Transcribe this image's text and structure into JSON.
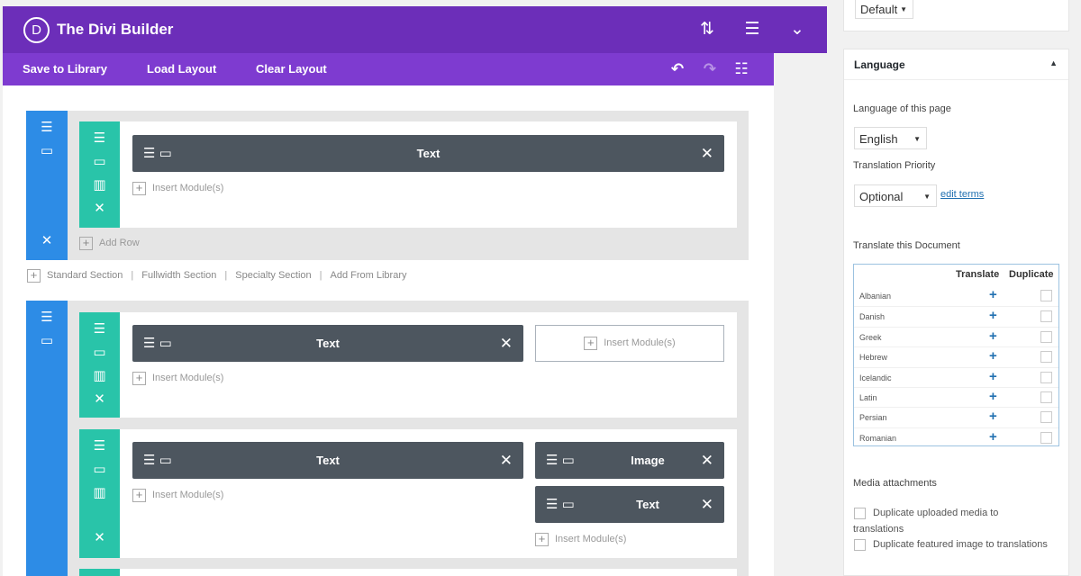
{
  "header": {
    "logo": "D",
    "title": "The Divi Builder",
    "icons": [
      "sort-arrows-icon",
      "hamburger-icon",
      "chevron-down-icon"
    ]
  },
  "toolbar": {
    "save": "Save to Library",
    "load": "Load Layout",
    "clear": "Clear Layout"
  },
  "modules": {
    "text": "Text",
    "image": "Image"
  },
  "insert": "Insert Module(s)",
  "add_row": "Add Row",
  "add_section": {
    "standard": "Standard Section",
    "fullwidth": "Fullwidth Section",
    "specialty": "Specialty Section",
    "library": "Add From Library",
    "sep": "|"
  },
  "sidebar": {
    "template_select": "Default",
    "language_box_title": "Language",
    "language_of_page": "Language of this page",
    "language_value": "English",
    "translation_priority": "Translation Priority",
    "priority_value": "Optional",
    "edit_terms": "edit terms",
    "translate_doc": "Translate this Document",
    "col_translate": "Translate",
    "col_duplicate": "Duplicate",
    "languages": [
      "Albanian",
      "Danish",
      "Greek",
      "Hebrew",
      "Icelandic",
      "Latin",
      "Persian",
      "Romanian"
    ],
    "media_title": "Media attachments",
    "dup_media_1": "Duplicate uploaded media to",
    "dup_media_2": "translations",
    "dup_featured": "Duplicate featured image to translations"
  },
  "colors": {
    "header": "#6c2eb9",
    "toolbar": "#7e3bd0",
    "section": "#2d8ce6",
    "row": "#29c4a9",
    "module": "#4d565f"
  }
}
